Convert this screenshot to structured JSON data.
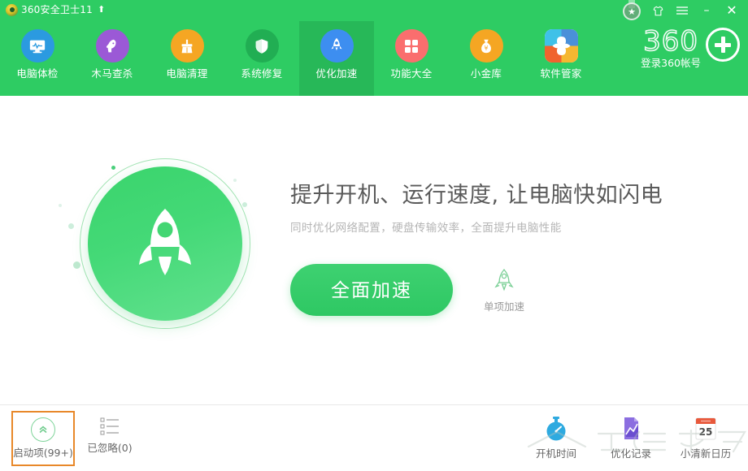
{
  "window": {
    "title": "360安全卫士11",
    "logo_icon": "360-shield-logo-icon",
    "up_arrow_icon": "arrow-up-icon",
    "controls": {
      "medal_icon": "medal-badge-icon",
      "skin_label": "skin-shirt-icon",
      "menu_label": "hamburger-menu-icon",
      "minimize_label": "–",
      "close_label": "✕"
    }
  },
  "nav": {
    "items": [
      {
        "label": "电脑体检",
        "icon": "monitor-checkup-icon",
        "color": "#2b9ae0",
        "active": false
      },
      {
        "label": "木马查杀",
        "icon": "trojan-scan-horse-icon",
        "color": "#9b59d6",
        "active": false
      },
      {
        "label": "电脑清理",
        "icon": "broom-clean-icon",
        "color": "#f5a623",
        "active": false
      },
      {
        "label": "系统修复",
        "icon": "shield-repair-icon",
        "color": "#21ae53",
        "active": false
      },
      {
        "label": "优化加速",
        "icon": "rocket-speedup-icon",
        "color": "#3d8ef0",
        "active": true
      },
      {
        "label": "功能大全",
        "icon": "grid-apps-icon",
        "color": "#fa6e6e",
        "active": false
      },
      {
        "label": "小金库",
        "icon": "money-bag-icon",
        "color": "#f5a623",
        "active": false
      },
      {
        "label": "软件管家",
        "icon": "software-manager-icon",
        "color": "#4a90d9",
        "active": false
      }
    ]
  },
  "account": {
    "brand": "360",
    "login_label": "登录360帐号",
    "plus_icon": "add-account-plus-icon"
  },
  "hero": {
    "badge_icon": "rocket-circle-icon",
    "headline": "提升开机、运行速度, 让电脑快如闪电",
    "subline": "同时优化网络配置，硬盘传输效率，全面提升电脑性能",
    "primary_button": "全面加速",
    "secondary_label": "单项加速",
    "secondary_icon": "rocket-outline-icon"
  },
  "footer": {
    "left_items": [
      {
        "label": "启动项(99+)",
        "icon": "chevron-up-circle-icon",
        "selected": true
      },
      {
        "label": "已忽略(0)",
        "icon": "list-lines-icon",
        "selected": false
      }
    ],
    "right_items": [
      {
        "label": "开机时间",
        "icon": "stopwatch-icon",
        "color": "#2eaae0"
      },
      {
        "label": "优化记录",
        "icon": "optimize-record-icon",
        "color": "#7a5cd6"
      },
      {
        "label": "小清新日历",
        "icon": "calendar-icon",
        "color": "#e8593c",
        "day": "25"
      }
    ]
  },
  "colors": {
    "header_green": "#2ecc63",
    "active_tab_green": "#27b858",
    "cta_green": "#2ec863",
    "selection_orange": "#e8882a"
  }
}
